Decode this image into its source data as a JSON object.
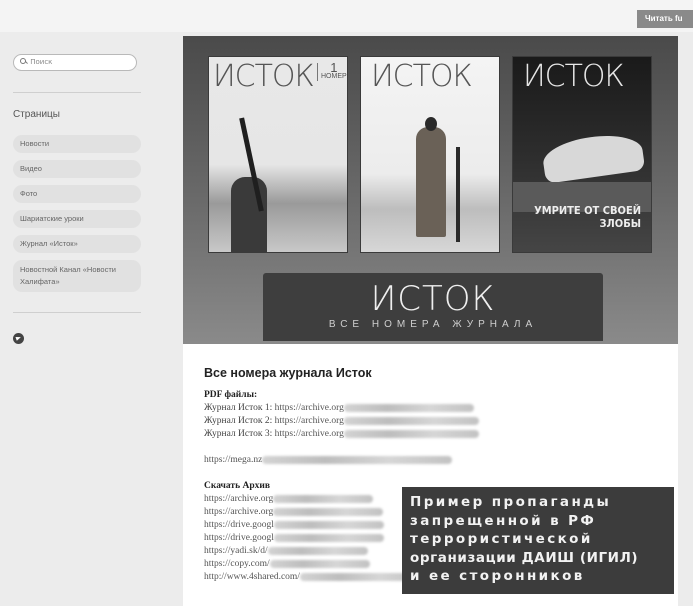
{
  "header": {
    "read_button": "Читать fu"
  },
  "sidebar": {
    "search_placeholder": "Поиск",
    "pages_title": "Страницы",
    "items": [
      {
        "label": "Новости"
      },
      {
        "label": "Видео"
      },
      {
        "label": "Фото"
      },
      {
        "label": "Шариатские уроки"
      },
      {
        "label": "Журнал «Исток»"
      },
      {
        "label": "Новостной Канал «Новости Халифата»"
      }
    ]
  },
  "banner": {
    "covers": [
      {
        "title": "ИСТОК",
        "issue_number": "1",
        "issue_label": "НОМЕР"
      },
      {
        "title": "ИСТОК"
      },
      {
        "title": "ИСТОК",
        "tagline": "УМРИТЕ ОТ СВОЕЙ ЗЛОБЫ"
      }
    ],
    "title": "ИСТОК",
    "subtitle": "ВСЕ НОМЕРА ЖУРНАЛА"
  },
  "article": {
    "heading": "Все номера журнала Исток",
    "pdf_label": "PDF файлы:",
    "pdf_items": [
      {
        "label": "Журнал Исток 1:",
        "url": "https://archive.org"
      },
      {
        "label": "Журнал Исток 2:",
        "url": "https://archive.org"
      },
      {
        "label": "Журнал Исток 3:",
        "url": "https://archive.org"
      }
    ],
    "mega_url": "https://mega.nz",
    "download_label": "Скачать Архив",
    "download_links": [
      "https://archive.org",
      "https://archive.org",
      "https://drive.googl",
      "https://drive.googl",
      "https://yadi.sk/d/",
      "https://copy.com/",
      "http://www.4shared.com/"
    ]
  },
  "notice": {
    "lines": [
      "Пример пропаганды",
      "запрещенной в РФ",
      "террористической",
      "организации ДАИШ (ИГИЛ)",
      "и ее сторонников"
    ]
  }
}
